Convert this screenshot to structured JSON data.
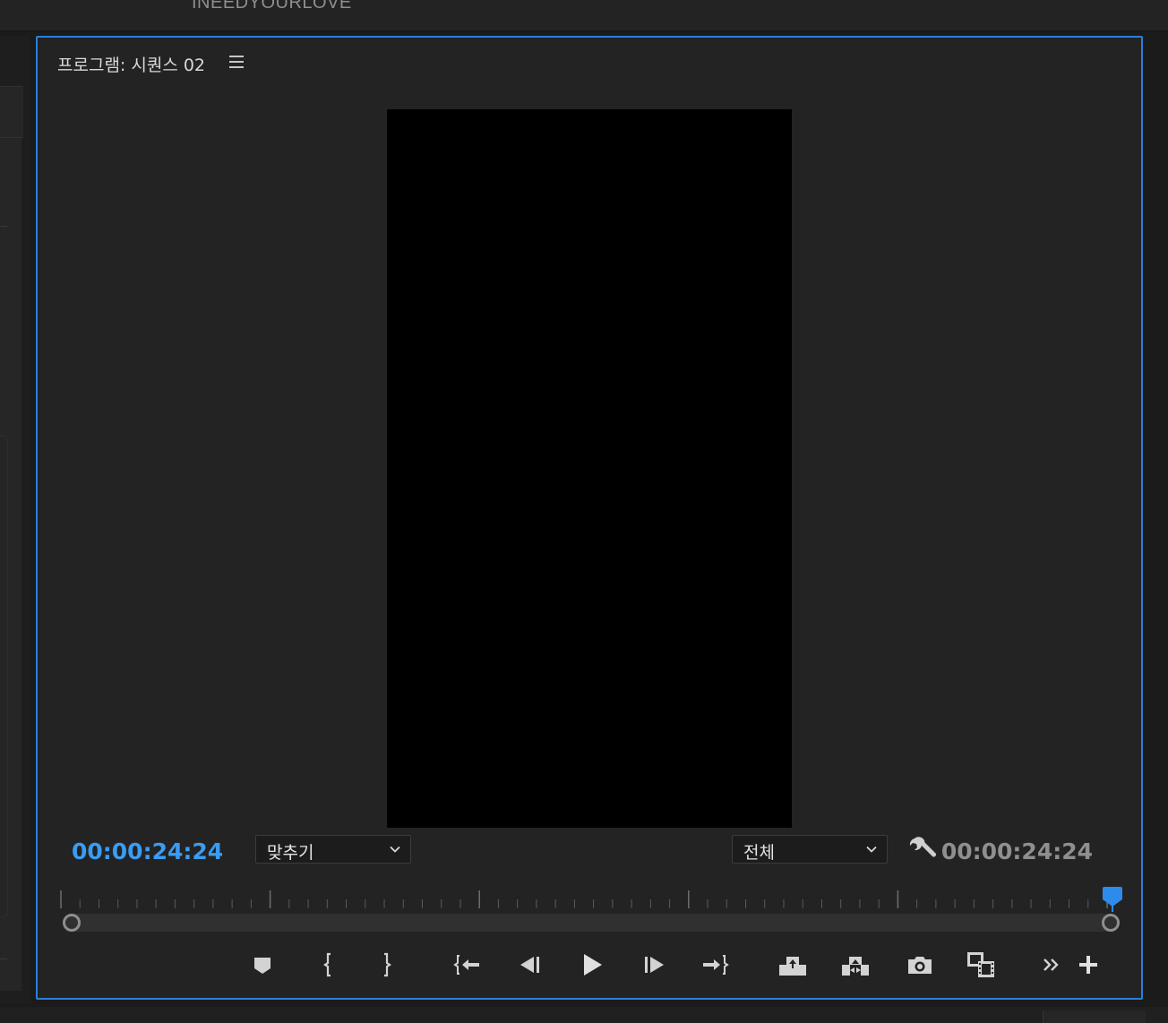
{
  "top_strip": {
    "title": "INEEDYOURLOVE"
  },
  "panel": {
    "title": "프로그램: 시퀀스 02",
    "menu_icon": "hamburger-menu-icon"
  },
  "timecode": {
    "current": "00:00:24:24",
    "duration": "00:00:24:24",
    "current_color": "#3a9cf2"
  },
  "zoom_dropdown": {
    "selected": "맞추기"
  },
  "resolution_dropdown": {
    "selected": "전체"
  },
  "settings_icon": "wrench-icon",
  "accent_color": "#2a7fdb",
  "transport": [
    {
      "id": "add-marker",
      "icon": "marker-icon"
    },
    {
      "id": "mark-in",
      "icon": "mark-in-icon"
    },
    {
      "id": "mark-out",
      "icon": "mark-out-icon"
    },
    {
      "id": "go-to-in",
      "icon": "go-to-in-icon"
    },
    {
      "id": "step-back",
      "icon": "step-back-icon"
    },
    {
      "id": "play",
      "icon": "play-icon"
    },
    {
      "id": "step-forward",
      "icon": "step-forward-icon"
    },
    {
      "id": "go-to-out",
      "icon": "go-to-out-icon"
    },
    {
      "id": "lift",
      "icon": "lift-icon"
    },
    {
      "id": "extract",
      "icon": "extract-icon"
    },
    {
      "id": "export-frame",
      "icon": "camera-icon"
    },
    {
      "id": "comparison-view",
      "icon": "comparison-view-icon"
    },
    {
      "id": "more",
      "icon": "chevrons-right-icon"
    },
    {
      "id": "button-editor",
      "icon": "plus-icon"
    }
  ]
}
